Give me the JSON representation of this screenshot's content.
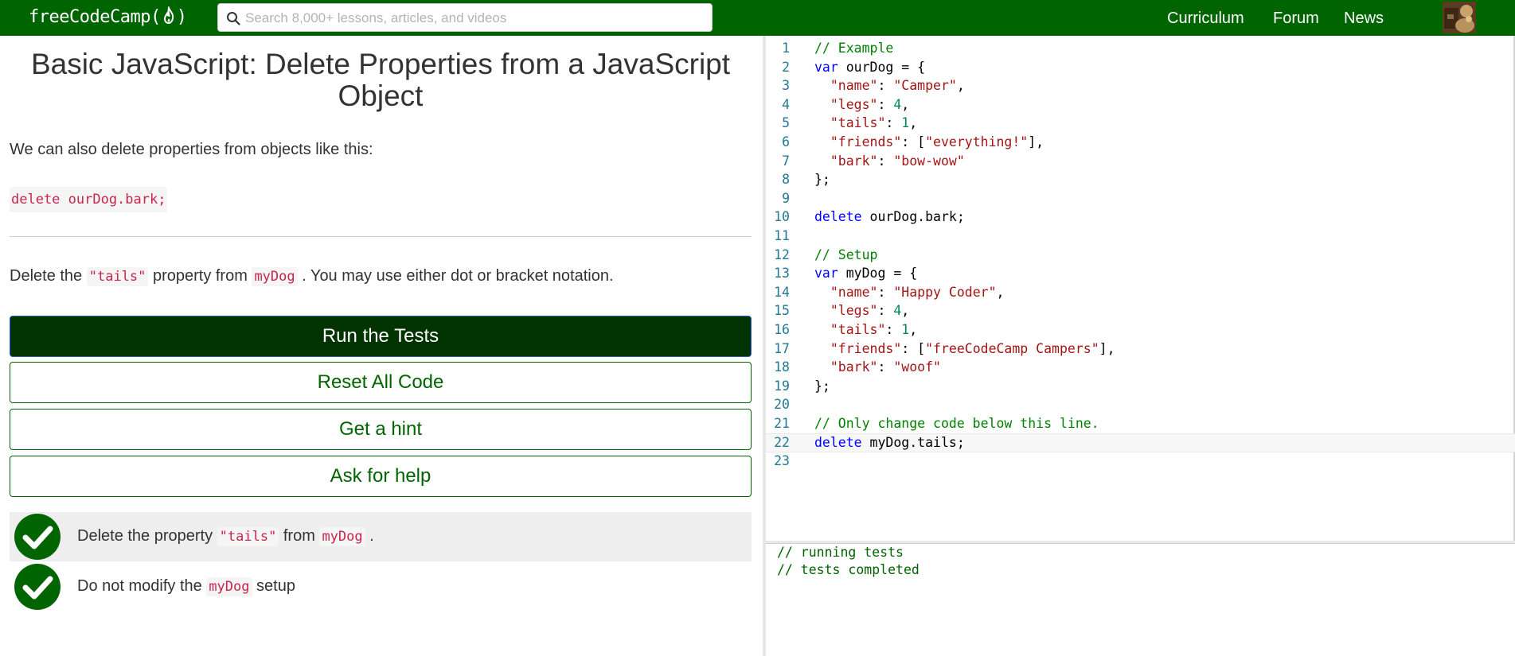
{
  "navbar": {
    "logo_text": "freeCodeCamp",
    "logo_paren_open": "(",
    "logo_paren_close": ")",
    "search_placeholder": "Search 8,000+ lessons, articles, and videos",
    "links": [
      "Curriculum",
      "Forum",
      "News"
    ],
    "avatar_icon": "user-avatar-icon"
  },
  "challenge": {
    "title": "Basic JavaScript: Delete Properties from a JavaScript Object",
    "intro": "We can also delete properties from objects like this:",
    "example_code": "delete ourDog.bark;",
    "instructions": {
      "prefix": "Delete the ",
      "code1": "\"tails\"",
      "mid": " property from ",
      "code2": "myDog",
      "suffix": " . You may use either dot or bracket notation."
    }
  },
  "buttons": {
    "run": "Run the Tests",
    "reset": "Reset All Code",
    "hint": "Get a hint",
    "help": "Ask for help"
  },
  "tests": [
    {
      "status": "passed",
      "prefix": "Delete the property ",
      "code1": "\"tails\"",
      "mid": " from ",
      "code2": "myDog",
      "suffix": " ."
    },
    {
      "status": "passed",
      "prefix": "Do not modify the ",
      "code1": "myDog",
      "mid": " setup",
      "code2": "",
      "suffix": ""
    }
  ],
  "editor": {
    "lines": [
      {
        "n": "1",
        "text": "// Example"
      },
      {
        "n": "2",
        "text": "var ourDog = {"
      },
      {
        "n": "3",
        "text": "  \"name\": \"Camper\","
      },
      {
        "n": "4",
        "text": "  \"legs\": 4,"
      },
      {
        "n": "5",
        "text": "  \"tails\": 1,"
      },
      {
        "n": "6",
        "text": "  \"friends\": [\"everything!\"],"
      },
      {
        "n": "7",
        "text": "  \"bark\": \"bow-wow\""
      },
      {
        "n": "8",
        "text": "};"
      },
      {
        "n": "9",
        "text": ""
      },
      {
        "n": "10",
        "text": "delete ourDog.bark;"
      },
      {
        "n": "11",
        "text": ""
      },
      {
        "n": "12",
        "text": "// Setup"
      },
      {
        "n": "13",
        "text": "var myDog = {"
      },
      {
        "n": "14",
        "text": "  \"name\": \"Happy Coder\","
      },
      {
        "n": "15",
        "text": "  \"legs\": 4,"
      },
      {
        "n": "16",
        "text": "  \"tails\": 1,"
      },
      {
        "n": "17",
        "text": "  \"friends\": [\"freeCodeCamp Campers\"],"
      },
      {
        "n": "18",
        "text": "  \"bark\": \"woof\""
      },
      {
        "n": "19",
        "text": "};"
      },
      {
        "n": "20",
        "text": ""
      },
      {
        "n": "21",
        "text": "// Only change code below this line."
      },
      {
        "n": "22",
        "text": "delete myDog.tails;"
      },
      {
        "n": "23",
        "text": ""
      }
    ],
    "active_line": "22"
  },
  "console": {
    "lines": [
      "// running tests",
      "// tests completed"
    ]
  },
  "colors": {
    "brand": "#006400",
    "run_button": "#003300",
    "check": "#006400",
    "inline_code": "#c7254e"
  }
}
